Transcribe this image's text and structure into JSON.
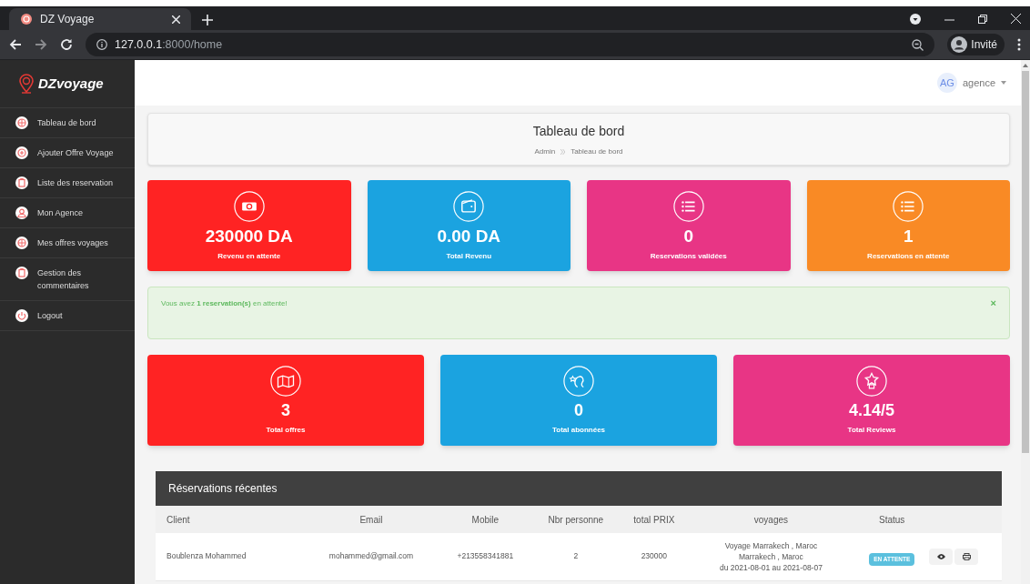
{
  "browser": {
    "tab_title": "DZ Voyage",
    "url_host": "127.0.0.1",
    "url_path": ":8000/home",
    "profile": "Invité"
  },
  "sidebar": {
    "brand": "DZvoyage",
    "items": [
      {
        "label": "Tableau de bord",
        "kind": "dashboard"
      },
      {
        "label": "Ajouter Offre Voyage",
        "kind": "add"
      },
      {
        "label": "Liste des reservation",
        "kind": "clipboard"
      },
      {
        "label": "Mon Agence",
        "kind": "user"
      },
      {
        "label": "Mes offres voyages",
        "kind": "dashboard"
      },
      {
        "label": "Gestion des commentaires",
        "kind": "clipboard"
      },
      {
        "label": "Logout",
        "kind": "power"
      }
    ]
  },
  "header": {
    "avatar": "AG",
    "user": "agence"
  },
  "page_header": {
    "title": "Tableau de bord",
    "breadcrumb": [
      "Admin",
      "Tableau de bord"
    ]
  },
  "stats": [
    {
      "value": "230000 DA",
      "label": "Revenu en attente",
      "color": "#ff2323",
      "kind": "money"
    },
    {
      "value": "0.00 DA",
      "label": "Total Revenu",
      "color": "#1ba3e0",
      "kind": "wallet"
    },
    {
      "value": "0",
      "label": "Reservations validées",
      "color": "#e83585",
      "kind": "list"
    },
    {
      "value": "1",
      "label": "Reservations en attente",
      "color": "#f98a25",
      "kind": "list"
    }
  ],
  "alert": {
    "text": "Vous avez **1 reservation(s)** en attente!",
    "close": "×"
  },
  "stats_2": [
    {
      "value": "3",
      "label": "Total offres",
      "color": "#ff2323",
      "kind": "map"
    },
    {
      "value": "0",
      "label": "Total abonnées",
      "color": "#1ba3e0",
      "kind": "follower"
    },
    {
      "value": "4.14/5",
      "label": "Total Reviews",
      "color": "#e83585",
      "kind": "star"
    }
  ],
  "table": {
    "title": "Réservations récentes",
    "columns": [
      "Client",
      "Email",
      "Mobile",
      "Nbr personne",
      "total PRIX",
      "voyages",
      "Status"
    ],
    "rows": [
      {
        "client": "Boublenza Mohammed",
        "email": "mohammed@gmail.com",
        "mobile": "+213558341881",
        "persons": "2",
        "total": "230000",
        "voyage": [
          "Voyage Marrakech , Maroc",
          "Marrakech , Maroc",
          "du 2021-08-01 au 2021-08-07"
        ],
        "status": "EN ATTENTE"
      }
    ]
  }
}
